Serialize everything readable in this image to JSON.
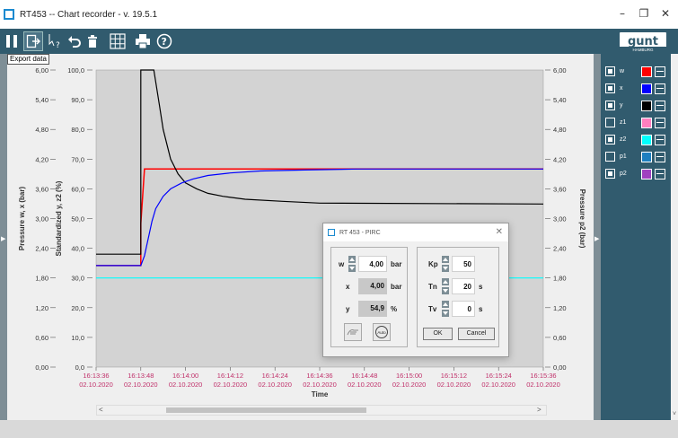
{
  "window": {
    "title": "RT453  --  Chart recorder - v. 19.5.1",
    "minimize": "–",
    "maximize": "❐",
    "close": "✕"
  },
  "toolbar": {
    "tooltip": "Export data",
    "logo_text": "gunt",
    "logo_sub": "HAMBURG",
    "icons": [
      "pause-icon",
      "export-icon",
      "help-cursor-icon",
      "undo-icon",
      "trash-icon",
      "grid-icon",
      "print-icon",
      "help-icon"
    ]
  },
  "legend": {
    "items": [
      {
        "label": "w",
        "checked": true,
        "color": "#ff0000"
      },
      {
        "label": "x",
        "checked": true,
        "color": "#0000ff"
      },
      {
        "label": "y",
        "checked": true,
        "color": "#000000"
      },
      {
        "label": "z1",
        "checked": false,
        "color": "#ff7fbf"
      },
      {
        "label": "z2",
        "checked": true,
        "color": "#00ffff"
      },
      {
        "label": "p1",
        "checked": false,
        "color": "#1f7fbf"
      },
      {
        "label": "p2",
        "checked": true,
        "color": "#a040c0"
      }
    ]
  },
  "chart_data": {
    "type": "line",
    "xlabel": "Time",
    "left_axis_title": "Pressure   w, x   (bar)",
    "left2_axis_title": "Standardized   y, z2   (%)",
    "right_axis_title": "Pressure   p2   (bar)",
    "y_left_ticks": [
      "6,00",
      "5,40",
      "4,80",
      "4,20",
      "3,60",
      "3,00",
      "2,40",
      "1,80",
      "1,20",
      "0,60",
      "0,00"
    ],
    "y_left2_ticks": [
      "100,0",
      "90,0",
      "80,0",
      "70,0",
      "60,0",
      "50,0",
      "40,0",
      "30,0",
      "20,0",
      "10,0",
      "0,0"
    ],
    "y_right_ticks": [
      "6,00",
      "5,40",
      "4,80",
      "4,20",
      "3,60",
      "3,00",
      "2,40",
      "1,80",
      "1,20",
      "0,60",
      "0,00"
    ],
    "x_ticks": [
      {
        "time": "16:13:36",
        "date": "02.10.2020"
      },
      {
        "time": "16:13:48",
        "date": "02.10.2020"
      },
      {
        "time": "16:14:00",
        "date": "02.10.2020"
      },
      {
        "time": "16:14:12",
        "date": "02.10.2020"
      },
      {
        "time": "16:14:24",
        "date": "02.10.2020"
      },
      {
        "time": "16:14:36",
        "date": "02.10.2020"
      },
      {
        "time": "16:14:48",
        "date": "02.10.2020"
      },
      {
        "time": "16:15:00",
        "date": "02.10.2020"
      },
      {
        "time": "16:15:12",
        "date": "02.10.2020"
      },
      {
        "time": "16:15:24",
        "date": "02.10.2020"
      },
      {
        "time": "16:15:36",
        "date": "02.10.2020"
      }
    ],
    "ylim_bar": [
      0,
      6
    ],
    "ylim_pct": [
      0,
      100
    ],
    "xlim_s": [
      0,
      120
    ],
    "series": [
      {
        "name": "w",
        "color": "#ff0000",
        "axis": "bar",
        "x": [
          0,
          12,
          12,
          13,
          120
        ],
        "y": [
          2.05,
          2.05,
          2.9,
          4.0,
          4.0
        ]
      },
      {
        "name": "x",
        "color": "#0000ff",
        "axis": "bar",
        "x": [
          0,
          12,
          13,
          14,
          15,
          16,
          18,
          20,
          23,
          26,
          30,
          36,
          44,
          56,
          70,
          120
        ],
        "y": [
          2.05,
          2.05,
          2.25,
          2.6,
          2.95,
          3.2,
          3.45,
          3.6,
          3.72,
          3.8,
          3.87,
          3.92,
          3.96,
          3.98,
          4.0,
          4.0
        ]
      },
      {
        "name": "y",
        "color": "#000000",
        "axis": "pct",
        "x": [
          0,
          12,
          12,
          15,
          15.5,
          17,
          18,
          20,
          22,
          24,
          27,
          30,
          34,
          40,
          50,
          60,
          120
        ],
        "y": [
          38,
          38,
          100,
          100,
          100,
          88,
          80,
          70,
          65,
          62,
          60,
          58.5,
          57.5,
          56.5,
          55.8,
          55.2,
          54.9
        ]
      },
      {
        "name": "z2",
        "color": "#00ffff",
        "axis": "pct",
        "x": [
          0,
          120
        ],
        "y": [
          30.0,
          30.0
        ]
      }
    ]
  },
  "scrollbar": {
    "left": "<",
    "right": ">"
  },
  "dialog": {
    "title": "RT 453 - PIRC",
    "close": "✕",
    "w_label": "w",
    "w_value": "4,00",
    "w_unit": "bar",
    "x_label": "x",
    "x_value": "4,00",
    "x_unit": "bar",
    "y_label": "y",
    "y_value": "54,9",
    "y_unit": "%",
    "kp_label": "Kp",
    "kp_value": "50",
    "tn_label": "Tn",
    "tn_value": "20",
    "tn_unit": "s",
    "tv_label": "Tv",
    "tv_value": "0",
    "tv_unit": "s",
    "ok_label": "OK",
    "cancel_label": "Cancel",
    "auto_label": "Auto"
  }
}
